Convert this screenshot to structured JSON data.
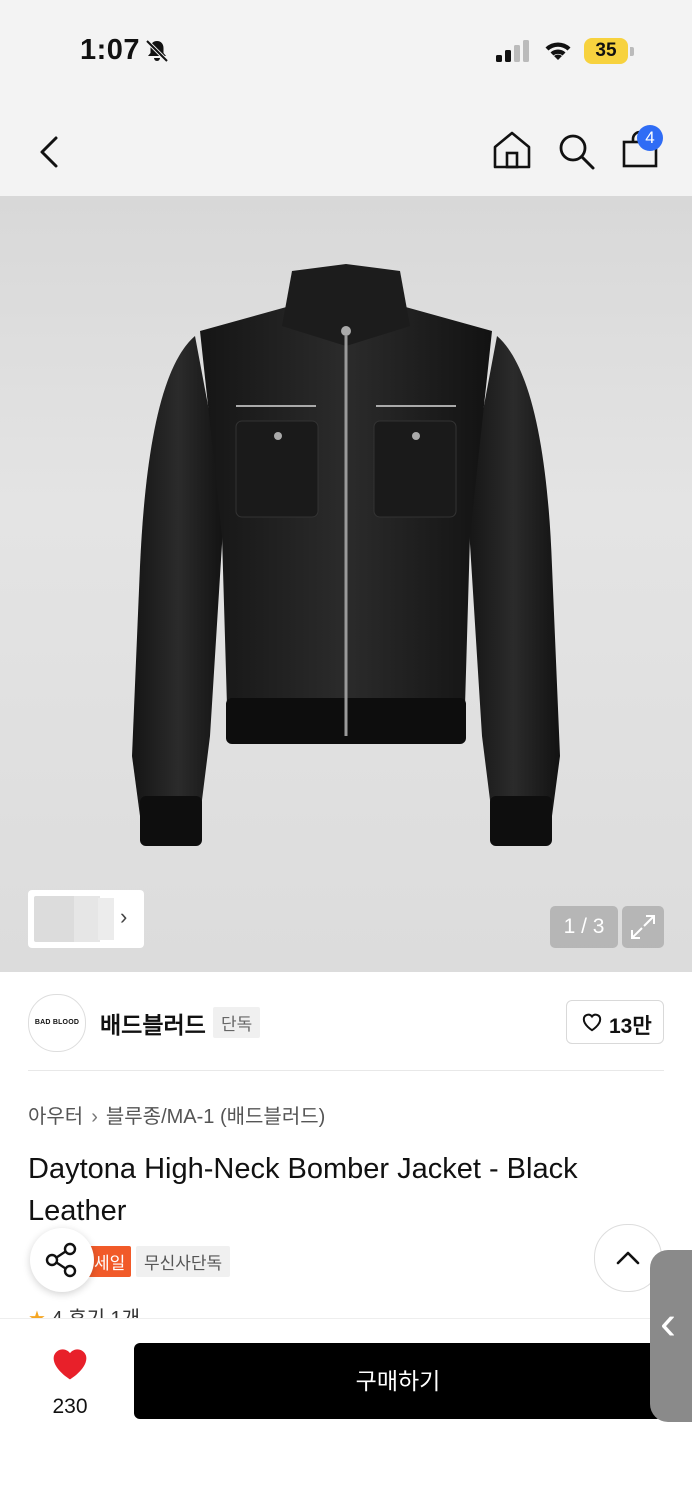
{
  "status_bar": {
    "time": "1:07",
    "battery_level": "35"
  },
  "nav": {
    "cart_count": "4"
  },
  "gallery": {
    "page_indicator": "1 / 3"
  },
  "brand": {
    "logo_text": "BAD BLOOD",
    "name": "배드블러드",
    "tag": "단독",
    "likes": "13만"
  },
  "breadcrumb": {
    "category": "아우터",
    "subcategory": "블루종/MA-1 (배드블러드)"
  },
  "product": {
    "title": "Daytona High-Neck Bomber Jacket - Black Leather"
  },
  "tags": {
    "sale": "세일",
    "exclusive": "무신사단독"
  },
  "rating": {
    "score": "4",
    "reviews": "후기 1개"
  },
  "bottom": {
    "wish_count": "230",
    "buy_label": "구매하기"
  },
  "colors": {
    "accent": "#2f6cf5",
    "sale": "#f15a29",
    "heart": "#e8202a",
    "battery": "#f7d23e"
  },
  "icons": [
    "bell-off-icon",
    "signal-icon",
    "wifi-icon",
    "back-icon",
    "home-icon",
    "search-icon",
    "bag-icon",
    "expand-icon",
    "heart-outline-icon",
    "share-icon",
    "chevron-up-icon",
    "heart-filled-icon",
    "chevron-left-icon",
    "star-icon"
  ]
}
